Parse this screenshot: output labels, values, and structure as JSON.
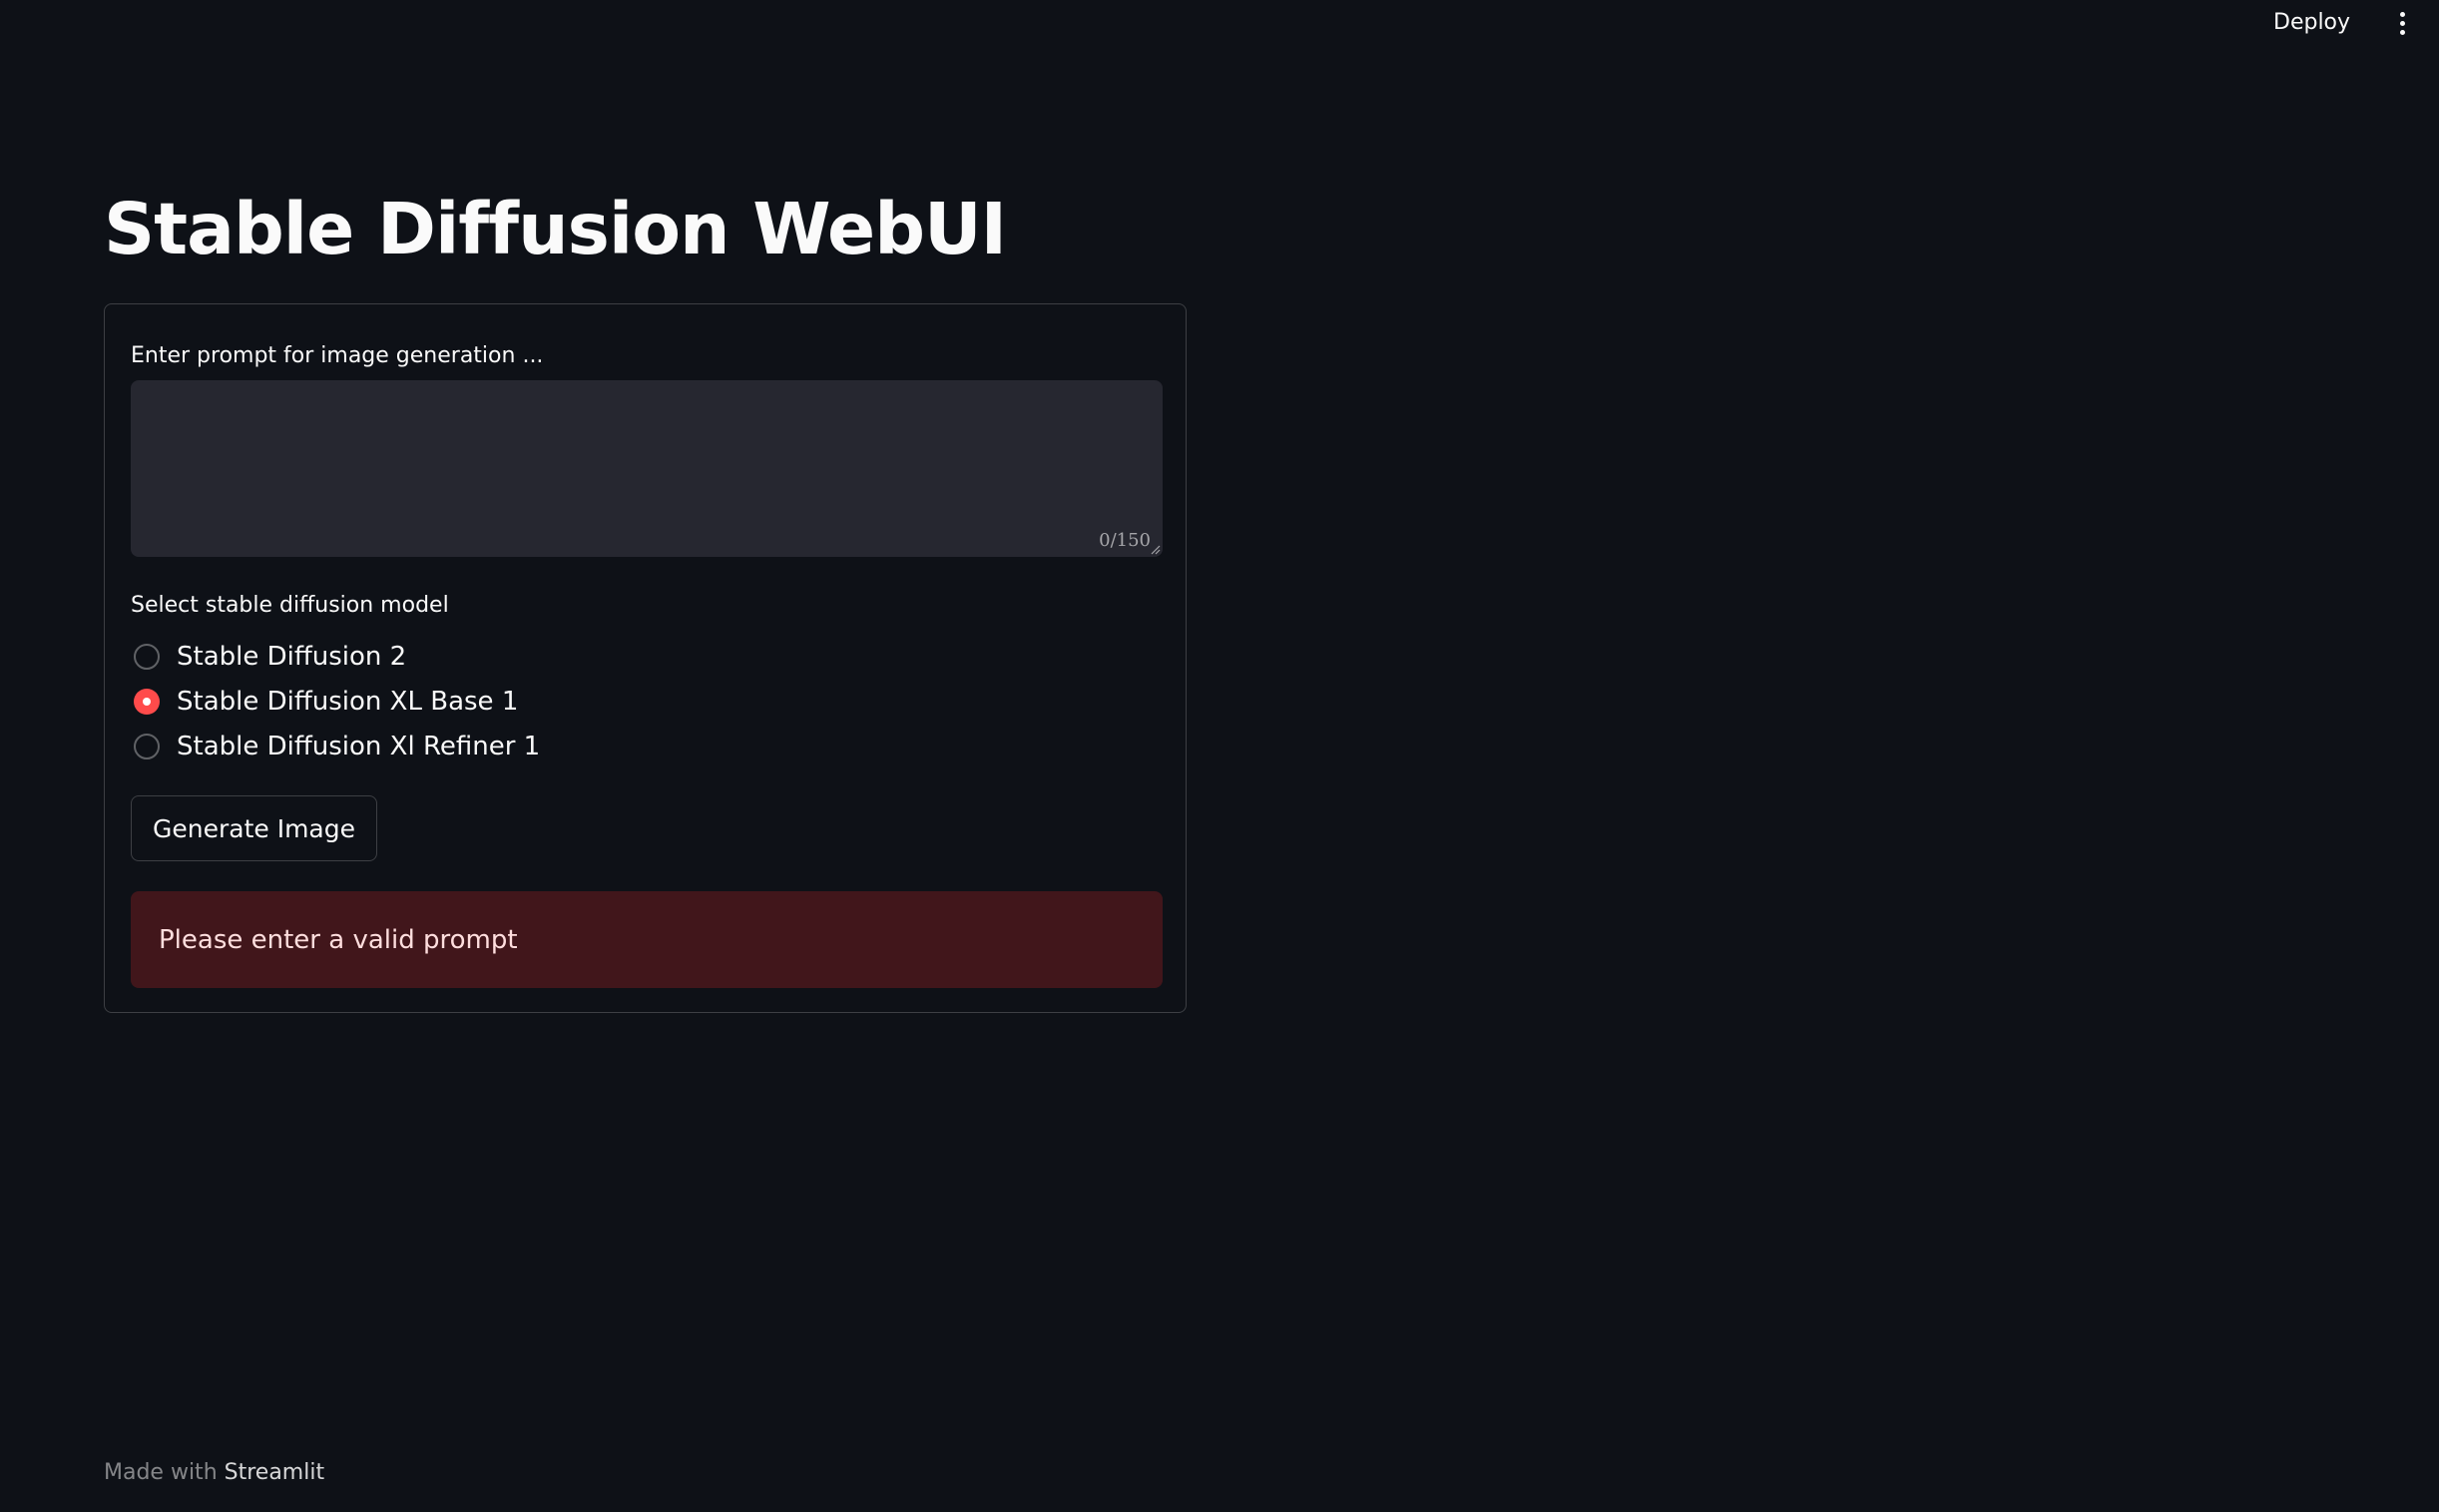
{
  "header": {
    "deploy_label": "Deploy",
    "menu_icon": "vertical-ellipsis-icon"
  },
  "page": {
    "title": "Stable Diffusion WebUI"
  },
  "form": {
    "prompt": {
      "label": "Enter prompt for image generation ...",
      "value": "",
      "counter": "0/150"
    },
    "model": {
      "label": "Select stable diffusion model",
      "options": [
        {
          "label": "Stable Diffusion 2",
          "selected": false
        },
        {
          "label": "Stable Diffusion XL Base 1",
          "selected": true
        },
        {
          "label": "Stable Diffusion Xl Refiner 1",
          "selected": false
        }
      ]
    },
    "generate_label": "Generate Image",
    "error_message": "Please enter a valid prompt"
  },
  "footer": {
    "prefix": "Made with ",
    "link": "Streamlit"
  },
  "colors": {
    "background": "#0e1117",
    "input_background": "#262730",
    "accent": "#ff4b4b",
    "error_background": "#442226",
    "text": "#fafafa"
  }
}
